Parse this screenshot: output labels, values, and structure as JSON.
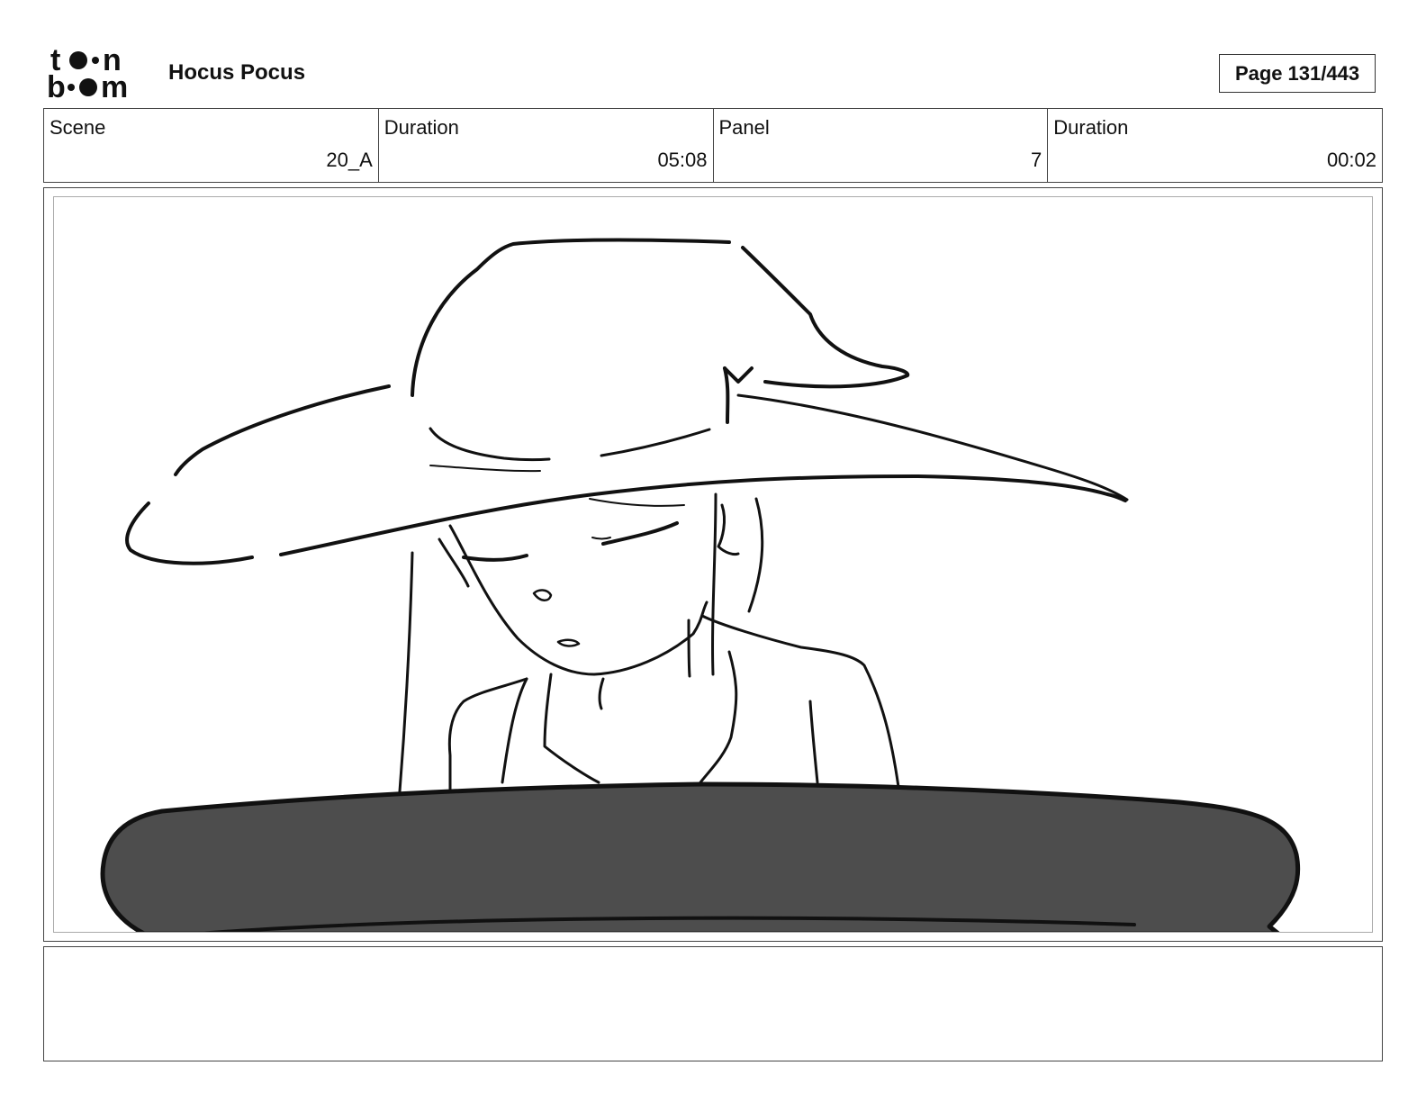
{
  "header": {
    "logo_text": "toonboom",
    "project_title": "Hocus Pocus",
    "page_label": "Page",
    "page_number": "131/443"
  },
  "info": {
    "scene_label": "Scene",
    "scene_value": "20_A",
    "scene_duration_label": "Duration",
    "scene_duration_value": "05:08",
    "panel_label": "Panel",
    "panel_value": "7",
    "panel_duration_label": "Duration",
    "panel_duration_value": "00:02"
  },
  "notes": {
    "text": ""
  }
}
